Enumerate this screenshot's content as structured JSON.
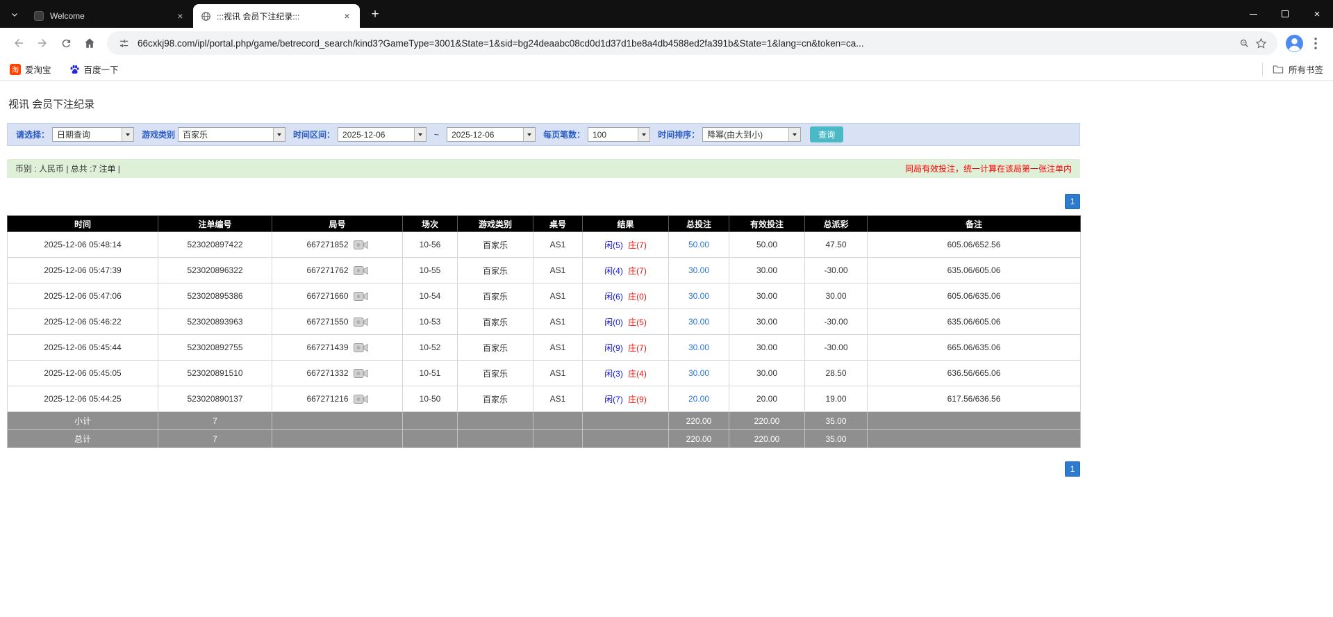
{
  "colors": {
    "accent_blue": "#2d7bd0",
    "player_blue": "#1414dd",
    "banker_red": "#e8160c",
    "negative_red": "#ff0000",
    "search_button_teal": "#49b9c6",
    "filter_bg": "#d9e2f4",
    "info_bg": "#dff0d8",
    "header_bg": "#000000",
    "sum_row_bg": "#8f8f8f"
  },
  "browser": {
    "tabs": [
      {
        "title": "Welcome"
      },
      {
        "title": ":::视讯 会员下注纪录:::"
      }
    ],
    "url": "66cxkj98.com/ipl/portal.php/game/betrecord_search/kind3?GameType=3001&State=1&sid=bg24deaabc08cd0d1d37d1be8a4db4588ed2fa391b&State=1&lang=cn&token=ca...",
    "bookmarks": [
      {
        "label": "爱淘宝",
        "icon_glyph": "淘"
      },
      {
        "label": "百度一下"
      }
    ],
    "all_bookmarks": "所有书签"
  },
  "page": {
    "title": "视讯 会员下注纪录",
    "filter": {
      "select_label": "请选择：",
      "query_type": "日期查询",
      "game_label": "游戏类别",
      "game_type": "百家乐",
      "range_label": "时间区间：",
      "date_from": "2025-12-06",
      "range_separator": "~",
      "date_to": "2025-12-06",
      "per_page_label": "每页笔数：",
      "per_page": "100",
      "sort_label": "时间排序：",
      "sort_order": "降幂(由大到小)",
      "search_button": "查询"
    },
    "info_bar": {
      "summary": "币别 : 人民币 | 总共 :7 注单 |",
      "notice": "同局有效投注，统一计算在该局第一张注单内"
    },
    "pagination": {
      "page": "1"
    },
    "table": {
      "headers": [
        "时间",
        "注单编号",
        "局号",
        "场次",
        "游戏类别",
        "桌号",
        "结果",
        "总投注",
        "有效投注",
        "总派彩",
        "备注"
      ],
      "rows": [
        {
          "time": "2025-12-06 05:48:14",
          "bet_no": "523020897422",
          "game_no": "667271852",
          "round": "10-56",
          "category": "百家乐",
          "table_no": "AS1",
          "player": "闲(5)",
          "banker": "庄(7)",
          "total_bet": "50.00",
          "valid_bet": "50.00",
          "payout": "47.50",
          "remark": "605.06/652.56"
        },
        {
          "time": "2025-12-06 05:47:39",
          "bet_no": "523020896322",
          "game_no": "667271762",
          "round": "10-55",
          "category": "百家乐",
          "table_no": "AS1",
          "player": "闲(4)",
          "banker": "庄(7)",
          "total_bet": "30.00",
          "valid_bet": "30.00",
          "payout": "-30.00",
          "remark": "635.06/605.06"
        },
        {
          "time": "2025-12-06 05:47:06",
          "bet_no": "523020895386",
          "game_no": "667271660",
          "round": "10-54",
          "category": "百家乐",
          "table_no": "AS1",
          "player": "闲(6)",
          "banker": "庄(0)",
          "total_bet": "30.00",
          "valid_bet": "30.00",
          "payout": "30.00",
          "remark": "605.06/635.06"
        },
        {
          "time": "2025-12-06 05:46:22",
          "bet_no": "523020893963",
          "game_no": "667271550",
          "round": "10-53",
          "category": "百家乐",
          "table_no": "AS1",
          "player": "闲(0)",
          "banker": "庄(5)",
          "total_bet": "30.00",
          "valid_bet": "30.00",
          "payout": "-30.00",
          "remark": "635.06/605.06"
        },
        {
          "time": "2025-12-06 05:45:44",
          "bet_no": "523020892755",
          "game_no": "667271439",
          "round": "10-52",
          "category": "百家乐",
          "table_no": "AS1",
          "player": "闲(9)",
          "banker": "庄(7)",
          "total_bet": "30.00",
          "valid_bet": "30.00",
          "payout": "-30.00",
          "remark": "665.06/635.06"
        },
        {
          "time": "2025-12-06 05:45:05",
          "bet_no": "523020891510",
          "game_no": "667271332",
          "round": "10-51",
          "category": "百家乐",
          "table_no": "AS1",
          "player": "闲(3)",
          "banker": "庄(4)",
          "total_bet": "30.00",
          "valid_bet": "30.00",
          "payout": "28.50",
          "remark": "636.56/665.06"
        },
        {
          "time": "2025-12-06 05:44:25",
          "bet_no": "523020890137",
          "game_no": "667271216",
          "round": "10-50",
          "category": "百家乐",
          "table_no": "AS1",
          "player": "闲(7)",
          "banker": "庄(9)",
          "total_bet": "20.00",
          "valid_bet": "20.00",
          "payout": "19.00",
          "remark": "617.56/636.56"
        }
      ],
      "subtotal": {
        "label": "小计",
        "count": "7",
        "total_bet": "220.00",
        "valid_bet": "220.00",
        "payout": "35.00"
      },
      "total": {
        "label": "总计",
        "count": "7",
        "total_bet": "220.00",
        "valid_bet": "220.00",
        "payout": "35.00"
      }
    }
  }
}
